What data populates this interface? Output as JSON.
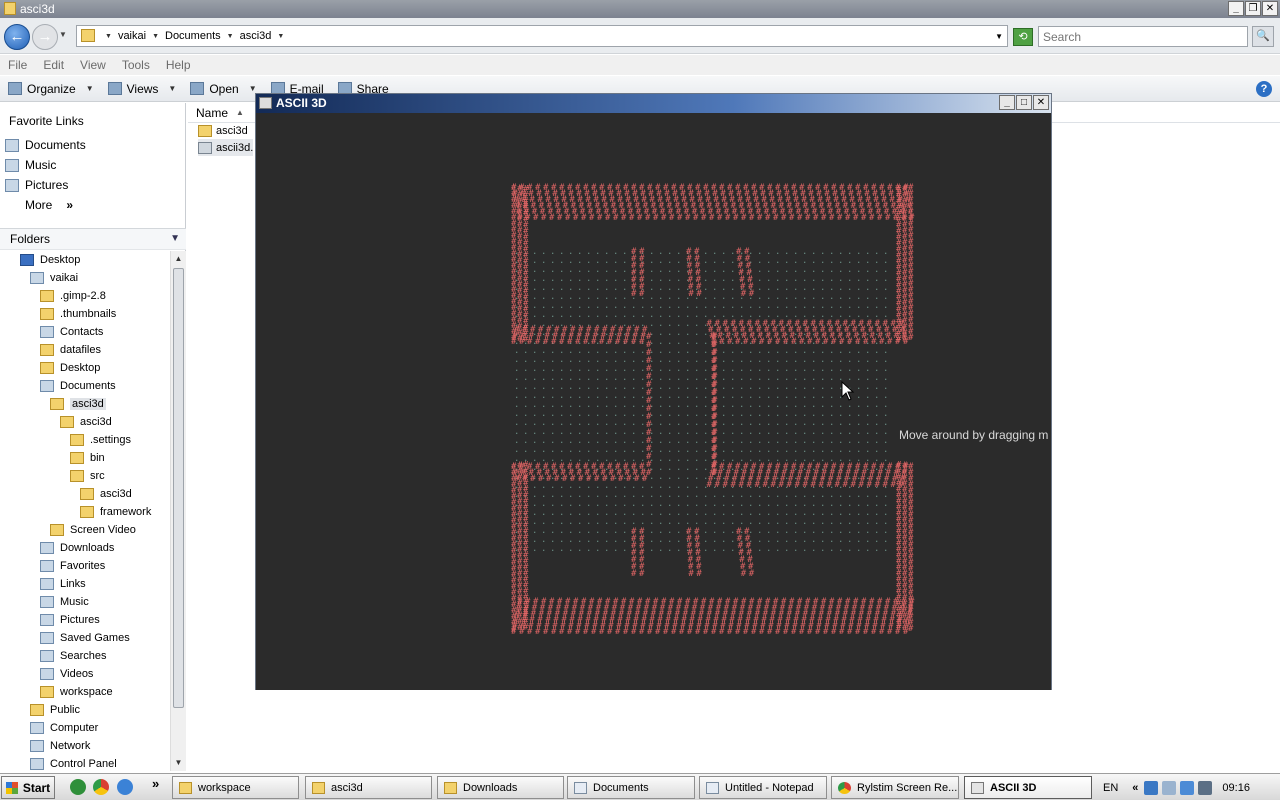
{
  "explorer": {
    "title": "asci3d",
    "breadcrumbs": [
      "vaikai",
      "Documents",
      "asci3d"
    ],
    "search_placeholder": "Search",
    "menu": [
      "File",
      "Edit",
      "View",
      "Tools",
      "Help"
    ],
    "toolbar": {
      "organize": "Organize",
      "views": "Views",
      "open": "Open",
      "email": "E-mail",
      "share": "Share"
    },
    "favorites_heading": "Favorite Links",
    "favorites": [
      "Documents",
      "Music",
      "Pictures"
    ],
    "more_label": "More",
    "folders_heading": "Folders",
    "tree": [
      {
        "label": "Desktop",
        "indent": 0,
        "icon": "desk"
      },
      {
        "label": "vaikai",
        "indent": 1,
        "icon": "sys"
      },
      {
        "label": ".gimp-2.8",
        "indent": 2,
        "icon": "folder"
      },
      {
        "label": ".thumbnails",
        "indent": 2,
        "icon": "folder"
      },
      {
        "label": "Contacts",
        "indent": 2,
        "icon": "sys"
      },
      {
        "label": "datafiles",
        "indent": 2,
        "icon": "folder"
      },
      {
        "label": "Desktop",
        "indent": 2,
        "icon": "folder"
      },
      {
        "label": "Documents",
        "indent": 2,
        "icon": "sys"
      },
      {
        "label": "asci3d",
        "indent": 3,
        "icon": "folder",
        "selected": true
      },
      {
        "label": "asci3d",
        "indent": 4,
        "icon": "folder"
      },
      {
        "label": ".settings",
        "indent": 5,
        "icon": "folder"
      },
      {
        "label": "bin",
        "indent": 5,
        "icon": "folder"
      },
      {
        "label": "src",
        "indent": 5,
        "icon": "folder"
      },
      {
        "label": "asci3d",
        "indent": 6,
        "icon": "folder"
      },
      {
        "label": "framework",
        "indent": 6,
        "icon": "folder"
      },
      {
        "label": "Screen Video",
        "indent": 3,
        "icon": "folder"
      },
      {
        "label": "Downloads",
        "indent": 2,
        "icon": "sys"
      },
      {
        "label": "Favorites",
        "indent": 2,
        "icon": "sys"
      },
      {
        "label": "Links",
        "indent": 2,
        "icon": "sys"
      },
      {
        "label": "Music",
        "indent": 2,
        "icon": "sys"
      },
      {
        "label": "Pictures",
        "indent": 2,
        "icon": "sys"
      },
      {
        "label": "Saved Games",
        "indent": 2,
        "icon": "sys"
      },
      {
        "label": "Searches",
        "indent": 2,
        "icon": "sys"
      },
      {
        "label": "Videos",
        "indent": 2,
        "icon": "sys"
      },
      {
        "label": "workspace",
        "indent": 2,
        "icon": "folder"
      },
      {
        "label": "Public",
        "indent": 1,
        "icon": "folder"
      },
      {
        "label": "Computer",
        "indent": 1,
        "icon": "sys"
      },
      {
        "label": "Network",
        "indent": 1,
        "icon": "sys"
      },
      {
        "label": "Control Panel",
        "indent": 1,
        "icon": "sys"
      }
    ],
    "name_column": "Name",
    "files": [
      {
        "name": "asci3d",
        "type": "folder"
      },
      {
        "name": "ascii3d.",
        "type": "jar",
        "selected": true
      }
    ]
  },
  "ascii_window": {
    "title": "ASCII 3D",
    "hint": "Move around by dragging m",
    "glyph": "#",
    "dot_glyph": ".",
    "colors": {
      "background": "#2b2b2b",
      "glyph": "#e06565",
      "dots": "#6b8f86"
    }
  },
  "taskbar": {
    "start_label": "Start",
    "tasks": [
      {
        "label": "workspace",
        "icon": "folder"
      },
      {
        "label": "asci3d",
        "icon": "folder"
      },
      {
        "label": "Downloads",
        "icon": "folder"
      },
      {
        "label": "Documents",
        "icon": "np"
      },
      {
        "label": "Untitled - Notepad",
        "icon": "np"
      },
      {
        "label": "Rylstim Screen Re...",
        "icon": "chr"
      },
      {
        "label": "ASCII 3D",
        "icon": "java",
        "active": true
      }
    ],
    "language": "EN",
    "clock": "09:16"
  }
}
